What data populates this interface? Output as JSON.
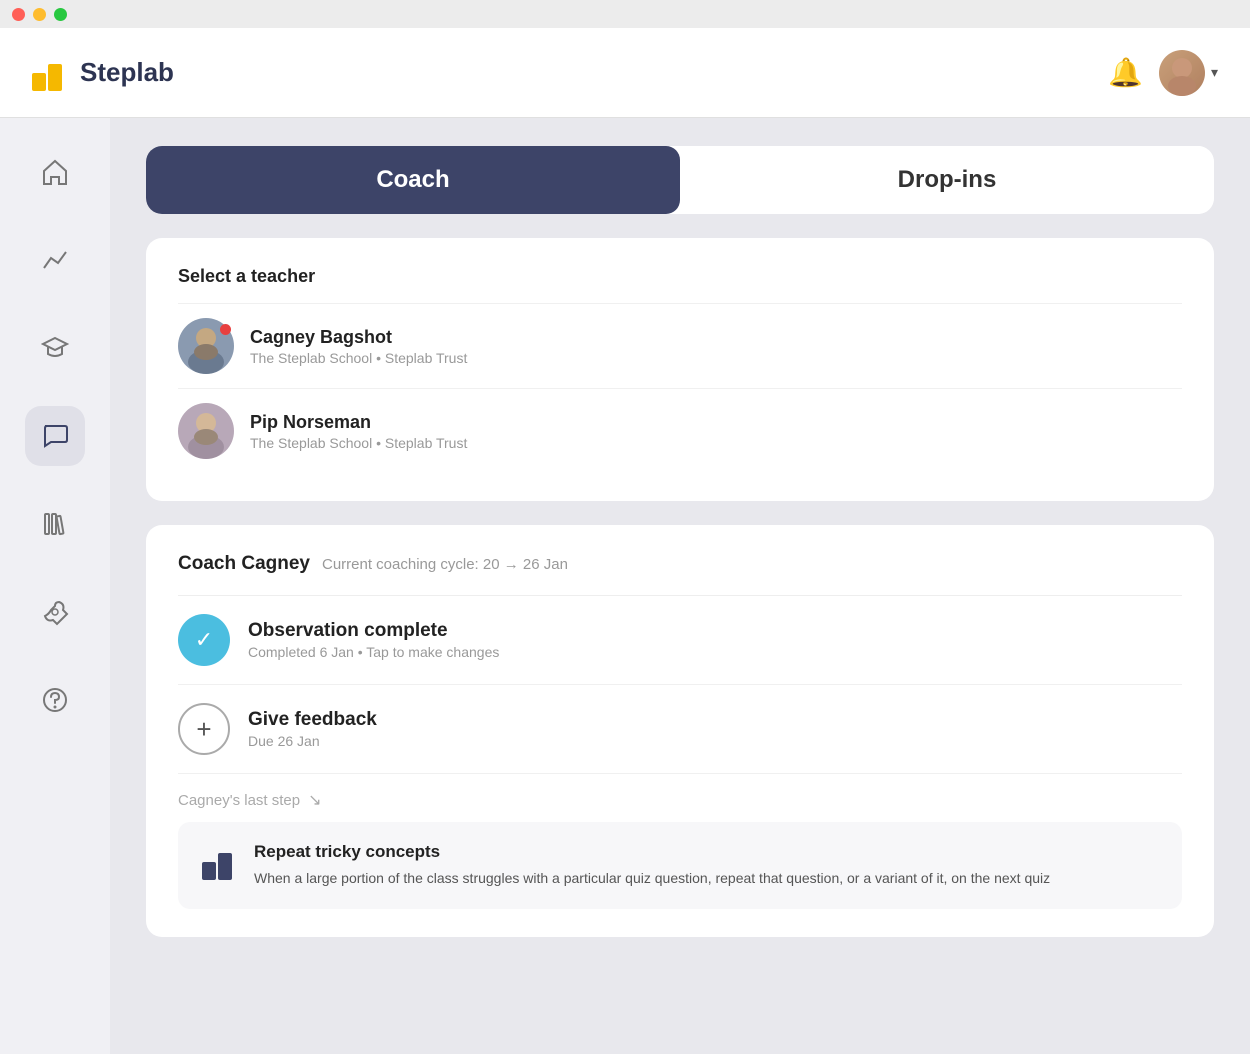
{
  "titlebar": {
    "dots": [
      "red",
      "yellow",
      "green"
    ]
  },
  "header": {
    "logo_text": "Steplab",
    "chevron": "▾"
  },
  "sidebar": {
    "items": [
      {
        "id": "home",
        "icon": "⌂",
        "active": false
      },
      {
        "id": "chart",
        "icon": "📈",
        "active": false
      },
      {
        "id": "graduation",
        "icon": "🎓",
        "active": false
      },
      {
        "id": "chat",
        "icon": "💬",
        "active": true
      },
      {
        "id": "library",
        "icon": "📚",
        "active": false
      },
      {
        "id": "tools",
        "icon": "🔧",
        "active": false
      },
      {
        "id": "help",
        "icon": "❓",
        "active": false
      }
    ]
  },
  "tabs": [
    {
      "id": "coach",
      "label": "Coach",
      "active": true
    },
    {
      "id": "dropins",
      "label": "Drop-ins",
      "active": false
    }
  ],
  "select_teacher": {
    "title": "Select a teacher",
    "teachers": [
      {
        "name": "Cagney Bagshot",
        "school": "The Steplab School • Steplab Trust",
        "gender": "male",
        "has_dot": true
      },
      {
        "name": "Pip Norseman",
        "school": "The Steplab School • Steplab Trust",
        "gender": "female",
        "has_dot": false
      }
    ]
  },
  "coach_section": {
    "coach_name": "Coach Cagney",
    "cycle_label": "Current coaching cycle: 20 → 26 Jan",
    "actions": [
      {
        "type": "complete",
        "title": "Observation complete",
        "sub": "Completed 6 Jan • Tap to make changes"
      },
      {
        "type": "plus",
        "title": "Give feedback",
        "sub": "Due 26 Jan"
      }
    ],
    "last_step_label": "Cagney's last step",
    "step": {
      "title": "Repeat tricky concepts",
      "description": "When a large portion of the class struggles with a particular quiz question, repeat that question, or a variant of it, on the next quiz"
    }
  }
}
